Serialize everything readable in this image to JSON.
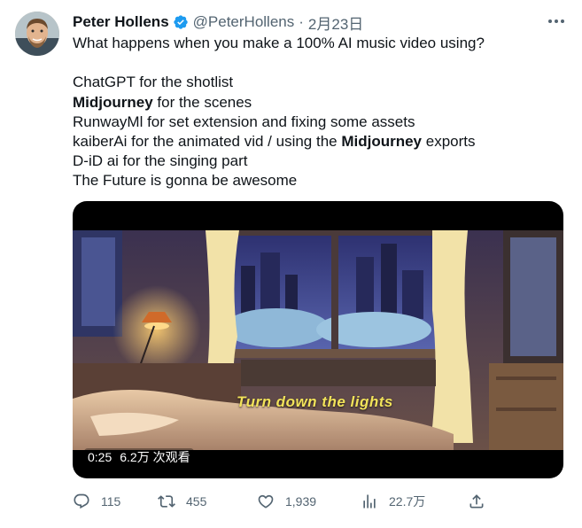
{
  "author": {
    "name": "Peter Hollens",
    "handle": "@PeterHollens",
    "separator": "·",
    "date": "2月23日",
    "verified": true
  },
  "tweet": {
    "lines": [
      {
        "parts": [
          {
            "text": "What happens when you make a 100% AI music video using?",
            "bold": false
          }
        ]
      },
      {
        "parts": []
      },
      {
        "parts": [
          {
            "text": "ChatGPT for the shotlist",
            "bold": false
          }
        ]
      },
      {
        "parts": [
          {
            "text": "Midjourney",
            "bold": true
          },
          {
            "text": " for the scenes",
            "bold": false
          }
        ]
      },
      {
        "parts": [
          {
            "text": "RunwayMl for set extension and fixing some assets",
            "bold": false
          }
        ]
      },
      {
        "parts": [
          {
            "text": "kaiberAi for the animated vid / using the ",
            "bold": false
          },
          {
            "text": "Midjourney",
            "bold": true
          },
          {
            "text": " exports",
            "bold": false
          }
        ]
      },
      {
        "parts": [
          {
            "text": "D-iD ai for the singing part",
            "bold": false
          }
        ]
      },
      {
        "parts": [
          {
            "text": "The Future is gonna be awesome",
            "bold": false
          }
        ]
      }
    ]
  },
  "video": {
    "caption": "Turn down the lights",
    "time": "0:25",
    "views": "6.2万 次观看"
  },
  "actions": {
    "replies": "115",
    "retweets": "455",
    "likes": "1,939",
    "views": "22.7万"
  },
  "colors": {
    "text": "#0f1419",
    "secondary": "#536471",
    "verified": "#1d9bf0",
    "caption": "#f2e35a"
  },
  "icons": [
    "verified-badge-icon",
    "more-icon",
    "reply-icon",
    "retweet-icon",
    "like-icon",
    "views-icon",
    "share-icon"
  ]
}
